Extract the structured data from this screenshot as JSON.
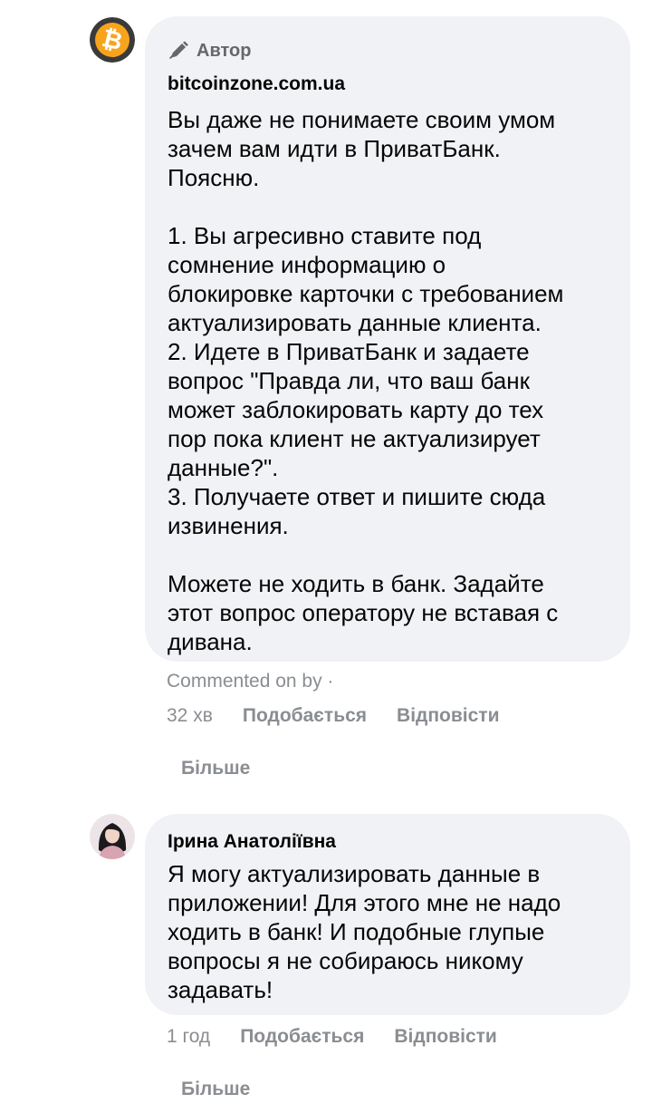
{
  "comments": [
    {
      "avatar_icon": "bitcoin-logo-icon",
      "author_badge": "Автор",
      "author_badge_icon": "pen-icon",
      "author_name": "bitcoinzone.com.ua",
      "text": "Вы даже не понимаете своим умом\nзачем вам идти в ПриватБанк.\nПоясню.\n\n1. Вы агресивно ставите под\nсомнение информацию о\nблокировке карточки с требованием\nактуализировать данные клиента.\n2. Идете в ПриватБанк и задаете\nвопрос \"Правда ли, что ваш банк\nможет заблокировать карту до тех\nпор пока клиент не актуализирует\nданные?\".\n3. Получаете ответ и пишите сюда\nизвинения.\n\nМожете не ходить в банк. Задайте\nэтот вопрос оператору не вставая с\nдивана.",
      "commented_on": "Commented on by ·",
      "time": "32 хв",
      "like_label": "Подобається",
      "reply_label": "Відповісти",
      "more_label": "Більше"
    },
    {
      "avatar_icon": "user-avatar-photo",
      "author_name": "Ірина Анатоліївна",
      "text": "Я могу актуализировать данные в\nприложении! Для этого мне не надо\nходить в банк! И подобные глупые\nвопросы я не собираюсь никому\nзадавать!",
      "time": "1 год",
      "like_label": "Подобається",
      "reply_label": "Відповісти",
      "more_label": "Більше"
    }
  ],
  "colors": {
    "bubble_bg": "#f0f2f5",
    "text_primary": "#050505",
    "text_secondary": "#8a8d91",
    "bitcoin_orange": "#f7931a"
  }
}
